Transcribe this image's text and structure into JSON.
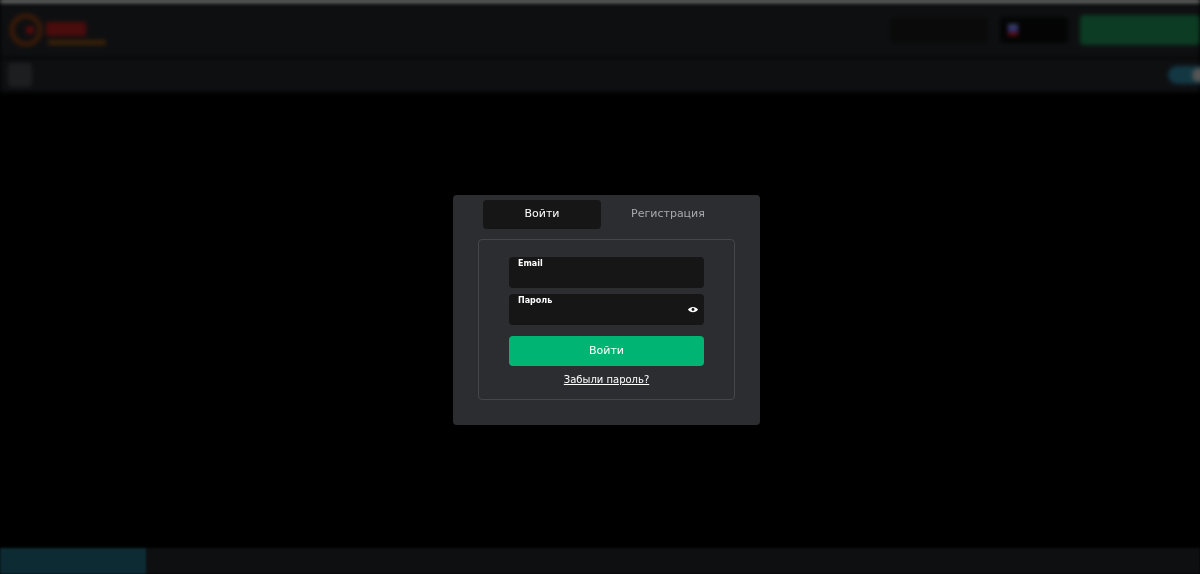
{
  "tabs": [
    {
      "label": "Войти",
      "selected": true
    },
    {
      "label": "Регистрация",
      "selected": false
    }
  ],
  "fields": [
    {
      "label": "Email",
      "kind": "text"
    },
    {
      "label": "Пароль",
      "kind": "password"
    }
  ],
  "submit": "Войти",
  "forgot_link": "Забыли пароль?",
  "toggle": {
    "on": true
  }
}
